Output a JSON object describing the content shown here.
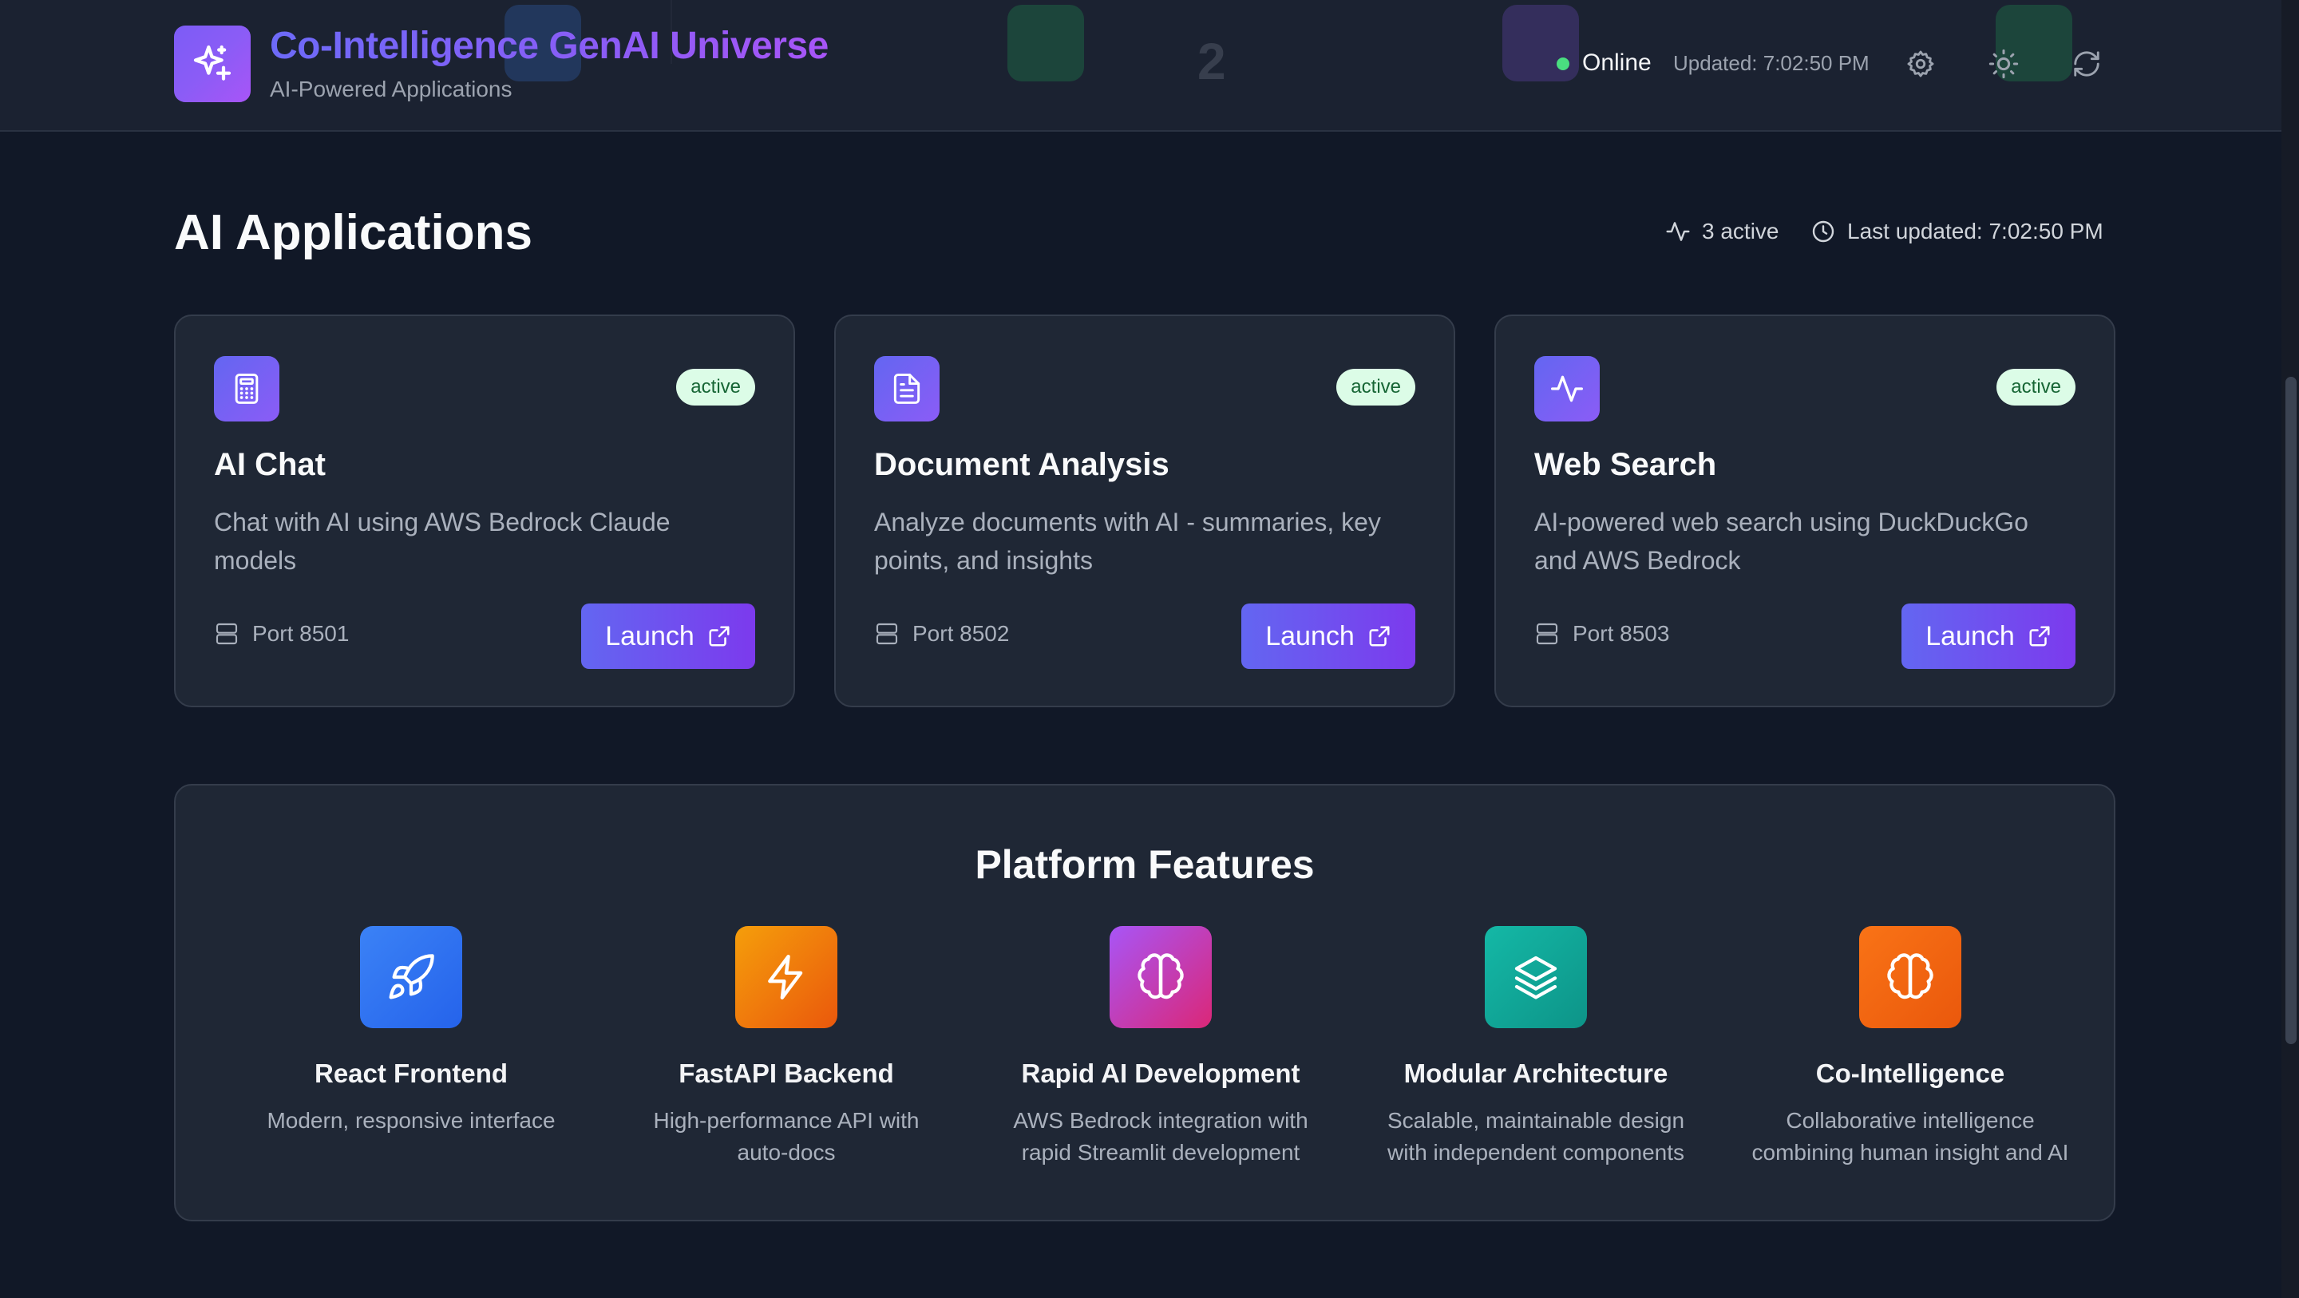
{
  "header": {
    "title": "Co-Intelligence GenAI Universe",
    "subtitle": "AI-Powered Applications",
    "status": "Online",
    "updated": "Updated: 7:02:50 PM",
    "colors": {
      "accent": "#8b5cf6",
      "online": "#4ade80"
    },
    "icons": [
      "sparkles-icon",
      "settings-icon",
      "theme-sun-icon",
      "refresh-icon"
    ]
  },
  "section": {
    "title": "AI Applications",
    "active_count": "3 active",
    "last_updated": "Last updated: 7:02:50 PM"
  },
  "apps": [
    {
      "name": "AI Chat",
      "status": "active",
      "description": "Chat with AI using AWS Bedrock Claude models",
      "port": "Port 8501",
      "launch": "Launch",
      "icon": "calculator-icon"
    },
    {
      "name": "Document Analysis",
      "status": "active",
      "description": "Analyze documents with AI - summaries, key points, and insights",
      "port": "Port 8502",
      "launch": "Launch",
      "icon": "document-icon"
    },
    {
      "name": "Web Search",
      "status": "active",
      "description": "AI-powered web search using DuckDuckGo and AWS Bedrock",
      "port": "Port 8503",
      "launch": "Launch",
      "icon": "activity-icon"
    }
  ],
  "features": {
    "title": "Platform Features",
    "items": [
      {
        "name": "React Frontend",
        "description": "Modern, responsive interface",
        "icon": "rocket-icon",
        "color": "#3b82f6"
      },
      {
        "name": "FastAPI Backend",
        "description": "High-performance API with auto-docs",
        "icon": "zap-icon",
        "color": "#f59e0b"
      },
      {
        "name": "Rapid AI Development",
        "description": "AWS Bedrock integration with rapid Streamlit development",
        "icon": "brain-icon",
        "color": "#c026d3"
      },
      {
        "name": "Modular Architecture",
        "description": "Scalable, maintainable design with independent components",
        "icon": "layers-icon",
        "color": "#14b8a6"
      },
      {
        "name": "Co-Intelligence",
        "description": "Collaborative intelligence combining human insight and AI",
        "icon": "brain-icon",
        "color": "#f97316"
      }
    ]
  }
}
